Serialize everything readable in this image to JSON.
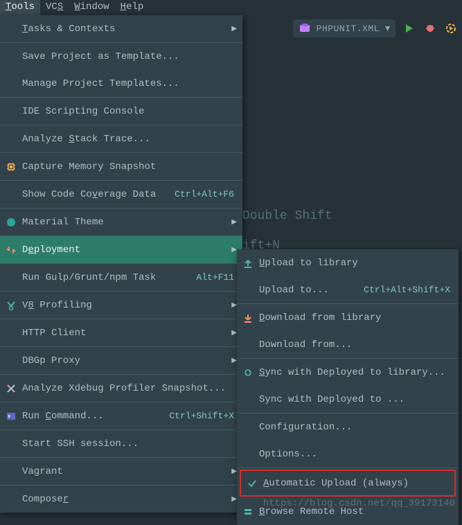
{
  "menubar": {
    "tools": "Tools",
    "vcs": "VCS",
    "window": "Window",
    "help": "Help"
  },
  "toolbar": {
    "run_config": "PHPUNIT.XML"
  },
  "bg": {
    "line1": "Double Shift",
    "line2": "ift+N"
  },
  "menu": {
    "tasks": "Tasks & Contexts",
    "save_template": "Save Project as Template...",
    "manage_templates": "Manage Project Templates...",
    "ide_scripting": "IDE Scripting Console",
    "stack_trace": "Analyze Stack Trace...",
    "memory_snapshot": "Capture Memory Snapshot",
    "coverage": "Show Code Coverage Data",
    "coverage_shortcut": "Ctrl+Alt+F6",
    "material_theme": "Material Theme",
    "deployment": "Deployment",
    "gulp": "Run Gulp/Grunt/npm Task",
    "gulp_shortcut": "Alt+F11",
    "v8": "V8 Profiling",
    "http_client": "HTTP Client",
    "dbgp": "DBGp Proxy",
    "xdebug": "Analyze Xdebug Profiler Snapshot...",
    "run_command": "Run Command...",
    "run_command_shortcut": "Ctrl+Shift+X",
    "ssh": "Start SSH session...",
    "vagrant": "Vagrant",
    "composer": "Composer"
  },
  "submenu": {
    "upload_lib": "Upload to library",
    "upload_to": "Upload to...",
    "upload_to_shortcut": "Ctrl+Alt+Shift+X",
    "download_lib": "Download from library",
    "download_from": "Download from...",
    "sync_lib": "Sync with Deployed to library...",
    "sync_deployed": "Sync with Deployed to ...",
    "configuration": "Configuration...",
    "options": "Options...",
    "auto_upload": "Automatic Upload (always)",
    "browse_remote": "Browse Remote Host"
  },
  "watermark": "https://blog.csdn.net/qq_39173140"
}
